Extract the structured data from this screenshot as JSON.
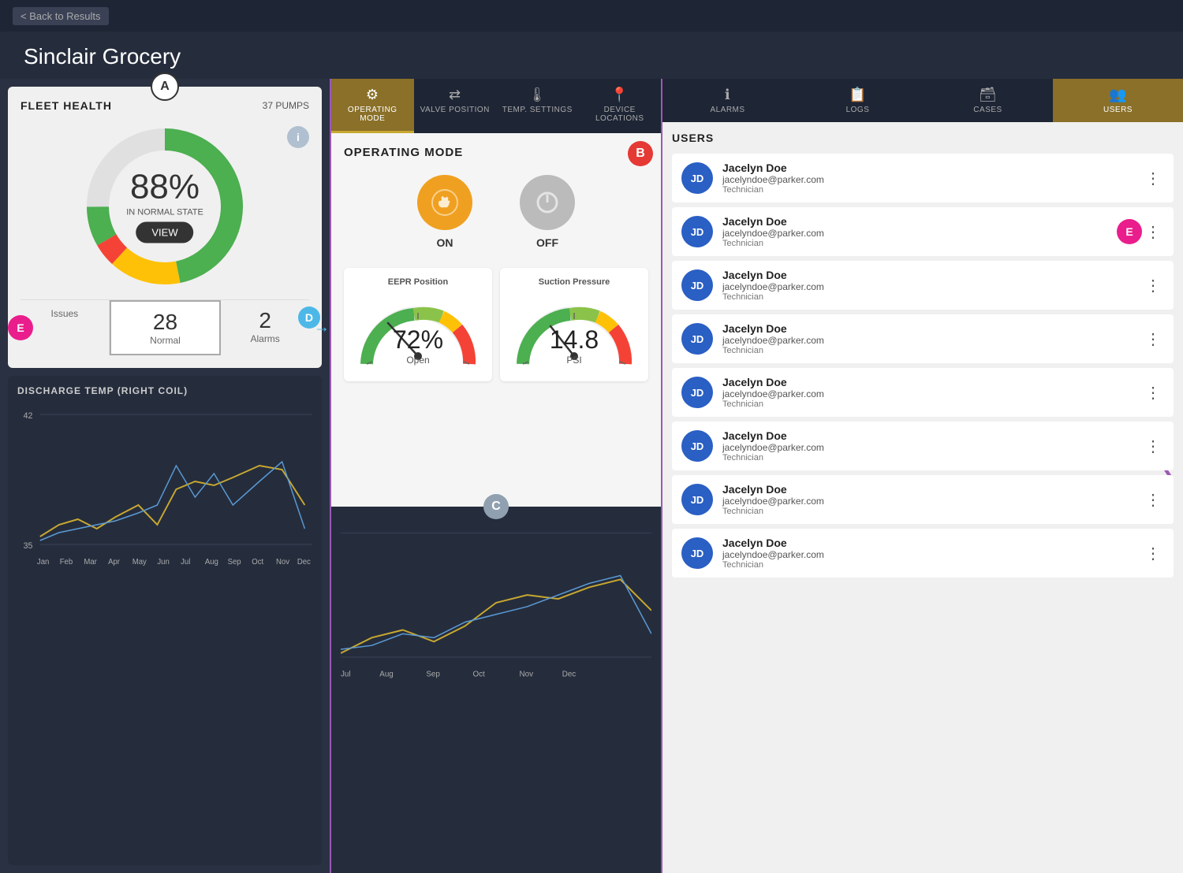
{
  "app": {
    "back_button": "< Back to Results",
    "title": "Sinclair Grocery"
  },
  "fleet": {
    "label": "FLEET HEALTH",
    "pumps": "37 PUMPS",
    "percent": "88%",
    "state": "IN NORMAL STATE",
    "view_btn": "VIEW",
    "stats": [
      {
        "id": "issues",
        "number": "",
        "label": "Issues"
      },
      {
        "id": "normal",
        "number": "28",
        "label": "Normal"
      },
      {
        "id": "alarms",
        "number": "2",
        "label": "Alarms"
      }
    ]
  },
  "discharge_chart": {
    "title": "DISCHARGE TEMP (RIGHT COIL)",
    "y_max": "42",
    "y_min": "35",
    "months": [
      "Jan",
      "Feb",
      "Mar",
      "Apr",
      "May",
      "Jun",
      "Jul",
      "Aug",
      "Sep",
      "Oct",
      "Nov",
      "Dec"
    ]
  },
  "tabs_middle": [
    {
      "id": "operating_mode",
      "label": "OPERATING MODE",
      "icon": "⚙",
      "active": true
    },
    {
      "id": "valve_position",
      "label": "VALVE POSITION",
      "icon": "⇄",
      "active": false
    },
    {
      "id": "temp_settings",
      "label": "TEMP. SETTINGS",
      "icon": "🌡",
      "active": false
    },
    {
      "id": "device_locations",
      "label": "DEVICE LOCATIONS",
      "icon": "📍",
      "active": false
    }
  ],
  "operating_mode": {
    "title": "OPERATING MODE",
    "on_label": "ON",
    "off_label": "OFF",
    "eepr_title": "EEPR Position",
    "eepr_value": "72%",
    "eepr_unit": "Open",
    "suction_title": "Suction Pressure",
    "suction_value": "14.8",
    "suction_unit": "PSI"
  },
  "tabs_right": [
    {
      "id": "alarms",
      "label": "ALARMS",
      "icon": "ℹ",
      "active": false
    },
    {
      "id": "logs",
      "label": "LOGS",
      "icon": "📋",
      "active": false
    },
    {
      "id": "cases",
      "label": "CASES",
      "icon": "🗃",
      "active": false
    },
    {
      "id": "users",
      "label": "USERS",
      "icon": "👥",
      "active": true
    }
  ],
  "users": {
    "header": "USERS",
    "items": [
      {
        "initials": "JD",
        "name": "Jacelyn Doe",
        "email": "jacelyndoe@parker.com",
        "role": "Technician",
        "highlight": false
      },
      {
        "initials": "JD",
        "name": "Jacelyn Doe",
        "email": "jacelyndoe@parker.com",
        "role": "Technician",
        "highlight": true
      },
      {
        "initials": "JD",
        "name": "Jacelyn Doe",
        "email": "jacelyndoe@parker.com",
        "role": "Technician",
        "highlight": false
      },
      {
        "initials": "JD",
        "name": "Jacelyn Doe",
        "email": "jacelyndoe@parker.com",
        "role": "Technician",
        "highlight": false
      },
      {
        "initials": "JD",
        "name": "Jacelyn Doe",
        "email": "jacelyndoe@parker.com",
        "role": "Technician",
        "highlight": false
      },
      {
        "initials": "JD",
        "name": "Jacelyn Doe",
        "email": "jacelyndoe@parker.com",
        "role": "Technician",
        "highlight": false
      },
      {
        "initials": "JD",
        "name": "Jacelyn Doe",
        "email": "jacelyndoe@parker.com",
        "role": "Technician",
        "highlight": false
      },
      {
        "initials": "JD",
        "name": "Jacelyn Doe",
        "email": "jacelyndoe@parker.com",
        "role": "Technician",
        "highlight": false
      }
    ]
  },
  "badges": {
    "a": "A",
    "b": "B",
    "c": "C",
    "d": "D",
    "e": "E"
  },
  "colors": {
    "purple": "#9b59b6",
    "pink": "#e91e8c",
    "blue_badge": "#4db8e8",
    "red_badge": "#e53935",
    "grey_badge": "#90a0b0",
    "user_avatar": "#2a5fc4",
    "tab_active_bg": "#8a7028"
  }
}
